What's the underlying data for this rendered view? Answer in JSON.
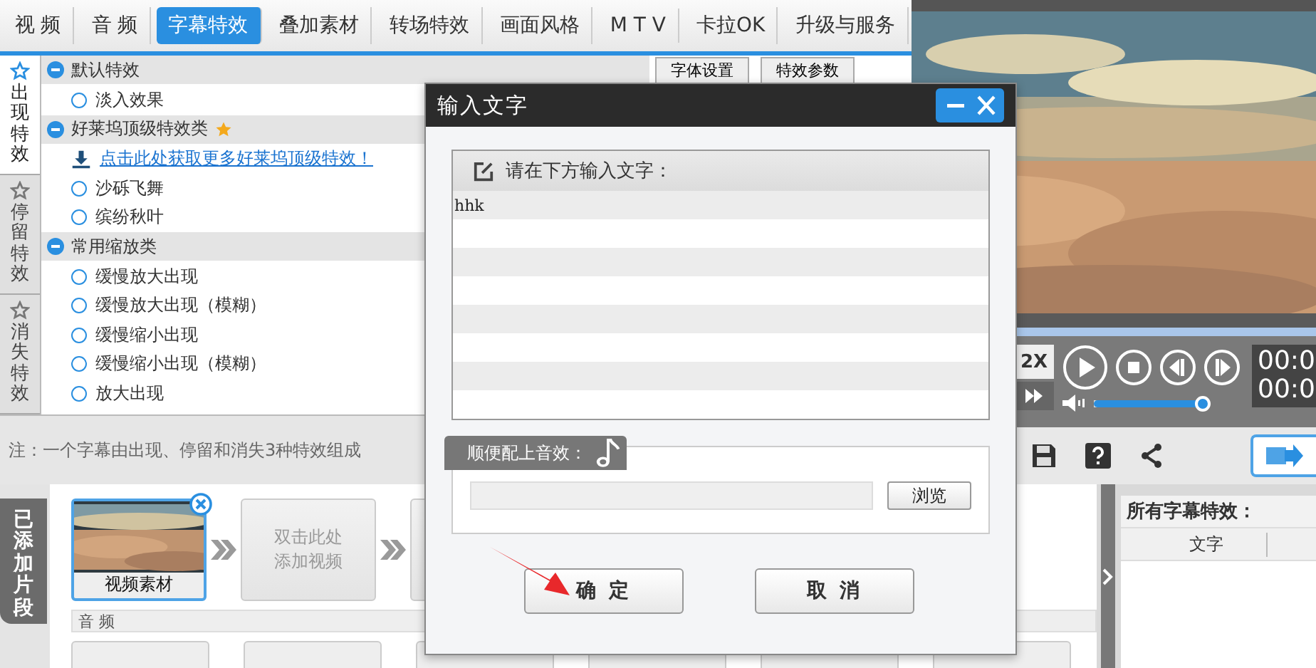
{
  "top_tabs": [
    {
      "label": "视 频",
      "selected": false
    },
    {
      "label": "音 频",
      "selected": false
    },
    {
      "label": "字幕特效",
      "selected": true
    },
    {
      "label": "叠加素材",
      "selected": false
    },
    {
      "label": "转场特效",
      "selected": false
    },
    {
      "label": "画面风格",
      "selected": false
    },
    {
      "label": "M T V",
      "selected": false
    },
    {
      "label": "卡拉OK",
      "selected": false
    },
    {
      "label": "升级与服务",
      "selected": false
    }
  ],
  "effect_tabs": [
    {
      "label": "出现特效",
      "selected": true
    },
    {
      "label": "停留特效",
      "selected": false
    },
    {
      "label": "消失特效",
      "selected": false
    }
  ],
  "effect_groups": [
    {
      "title": "默认特效",
      "expanded": true,
      "starred": false,
      "children": [
        {
          "kind": "radio",
          "label": "淡入效果",
          "selected": false
        }
      ]
    },
    {
      "title": "好莱坞顶级特效类",
      "expanded": true,
      "starred": true,
      "children": [
        {
          "kind": "link",
          "label": "点击此处获取更多好莱坞顶级特效！"
        },
        {
          "kind": "radio",
          "label": "沙砾飞舞",
          "selected": false
        },
        {
          "kind": "radio",
          "label": "缤纷秋叶",
          "selected": false
        }
      ]
    },
    {
      "title": "常用缩放类",
      "expanded": true,
      "starred": false,
      "children": [
        {
          "kind": "radio",
          "label": "缓慢放大出现",
          "selected": false
        },
        {
          "kind": "radio",
          "label": "缓慢放大出现（模糊）",
          "selected": false
        },
        {
          "kind": "radio",
          "label": "缓慢缩小出现",
          "selected": false
        },
        {
          "kind": "radio",
          "label": "缓慢缩小出现（模糊）",
          "selected": false
        },
        {
          "kind": "radio",
          "label": "放大出现",
          "selected": false
        }
      ]
    }
  ],
  "settings_tabs": [
    "字体设置",
    "特效参数"
  ],
  "note": "注：一个字幕由出现、停留和消失3种特效组成",
  "player": {
    "speed": "2X",
    "times": [
      "00:0",
      "00:0"
    ],
    "volume": {
      "level": 0.95
    }
  },
  "clips_panel": {
    "tab_label": "已添加片段",
    "clips": [
      {
        "kind": "video",
        "label": "视频素材"
      },
      {
        "kind": "placeholder",
        "lines": [
          "双击此处",
          "添加视频"
        ]
      }
    ],
    "audio_label": "音 频"
  },
  "effects_list": {
    "title": "所有字幕特效：",
    "columns": [
      "文字"
    ]
  },
  "dialog": {
    "title": "输入文字",
    "prompt": "请在下方输入文字：",
    "lines": [
      "hhk"
    ],
    "sound_label": "顺便配上音效：",
    "browse": "浏览",
    "buttons": [
      "确 定",
      "取 消"
    ]
  }
}
